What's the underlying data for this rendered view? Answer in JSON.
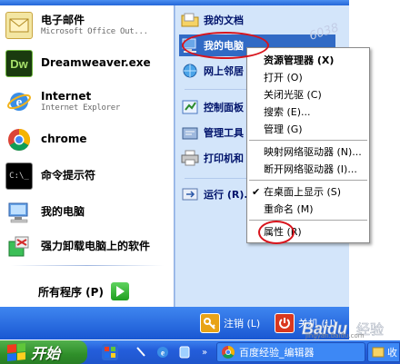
{
  "left_pane": {
    "pinned": [
      {
        "title": "电子邮件",
        "subtitle": "Microsoft Office Out..."
      },
      {
        "title": "Dreamweaver.exe"
      },
      {
        "title": "Internet",
        "subtitle": "Internet Explorer"
      }
    ],
    "recent": [
      {
        "title": "chrome"
      },
      {
        "title": "命令提示符"
      },
      {
        "title": "我的电脑"
      },
      {
        "title": "强力卸载电脑上的软件"
      }
    ],
    "all_programs_label": "所有程序 (P)"
  },
  "right_pane": {
    "items": [
      {
        "label": "我的文档"
      },
      {
        "label": "我的电脑"
      },
      {
        "label": "网上邻居"
      },
      {
        "label": "控制面板"
      },
      {
        "label": "管理工具"
      },
      {
        "label": "打印机和"
      },
      {
        "label": "运行 (R)..."
      }
    ]
  },
  "context_menu": {
    "items": [
      {
        "label": "资源管理器 (X)"
      },
      {
        "label": "打开 (O)"
      },
      {
        "label": "关闭光驱 (C)"
      },
      {
        "label": "搜索 (E)..."
      },
      {
        "label": "管理 (G)"
      },
      {
        "label": "映射网络驱动器 (N)..."
      },
      {
        "label": "断开网络驱动器 (I)..."
      },
      {
        "label": "在桌面上显示 (S)"
      },
      {
        "label": "重命名 (M)"
      },
      {
        "label": "属性 (R)"
      }
    ],
    "check_mark": "✔"
  },
  "bottom_bar": {
    "logoff_label": "注销 (L)",
    "shutdown_label": "关机 (U)"
  },
  "taskbar": {
    "start_label": "开始",
    "tasks": [
      {
        "label": "百度经验_编辑器"
      },
      {
        "label": "收"
      }
    ]
  },
  "watermark": {
    "brand": "Baidu 经验",
    "url": "jingyan.baidu.com",
    "corner_text": "6038"
  },
  "colors": {
    "menu_blue": "#1d5ed8",
    "highlight": "#316ac5",
    "annotation_red": "#d8141c",
    "start_green": "#2f8f2a"
  }
}
